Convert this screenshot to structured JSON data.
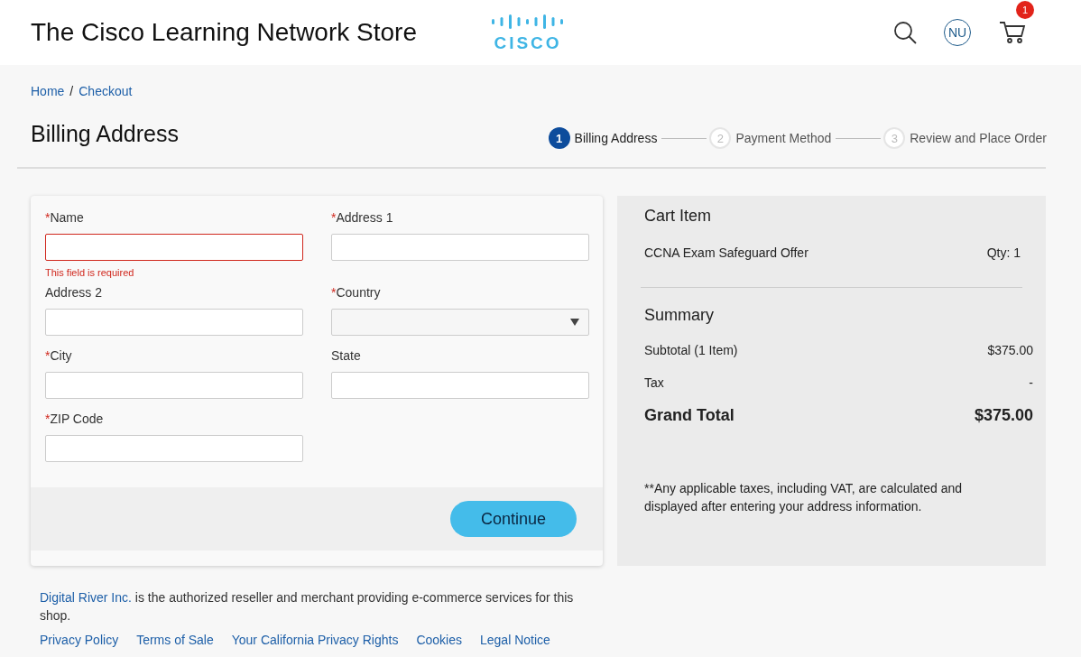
{
  "header": {
    "title": "The Cisco Learning Network Store",
    "logo": "CISCO",
    "avatar": "NU",
    "cart_count": "1"
  },
  "breadcrumb": [
    "Home",
    "Checkout"
  ],
  "breadcrumb_separator": "/",
  "page_title": "Billing Address",
  "steps": [
    {
      "number": "1",
      "label": "Billing Address",
      "selected": true
    },
    {
      "number": "2",
      "label": "Payment Method",
      "selected": false
    },
    {
      "number": "3",
      "label": "Review and Place Order",
      "selected": false
    }
  ],
  "form": {
    "fields": [
      {
        "kind": "text",
        "mark": "*",
        "label": "Name",
        "invalid": true,
        "error": "This field is required"
      },
      {
        "kind": "text",
        "mark": "*",
        "label": "Address 1"
      },
      {
        "kind": "text",
        "label": "Address 2"
      },
      {
        "kind": "select",
        "mark": "*",
        "label": "Country"
      },
      {
        "kind": "text",
        "mark": "*",
        "label": "City"
      },
      {
        "kind": "text",
        "label": "State"
      },
      {
        "kind": "text",
        "mark": "*",
        "label": "ZIP Code"
      }
    ],
    "button": "Continue"
  },
  "cart": {
    "title": "Cart Item",
    "item": "CCNA Exam Safeguard Offer",
    "qty": "Qty: 1"
  },
  "summary": {
    "title": "Summary",
    "rows": [
      {
        "label": "Subtotal (1 Item)",
        "value": "$375.00",
        "total": false
      },
      {
        "label": "Tax",
        "value": "-",
        "total": false
      },
      {
        "label": "Grand Total",
        "value": "$375.00",
        "total": true
      }
    ],
    "note": "**Any applicable taxes, including VAT, are calculated and displayed after entering your address information."
  },
  "footer": {
    "link": "Digital River Inc.",
    "text": " is the authorized reseller and merchant providing e-commerce services for this shop.",
    "links": [
      "Privacy Policy",
      "Terms of Sale",
      "Your California Privacy Rights",
      "Cookies",
      "Legal Notice"
    ]
  }
}
